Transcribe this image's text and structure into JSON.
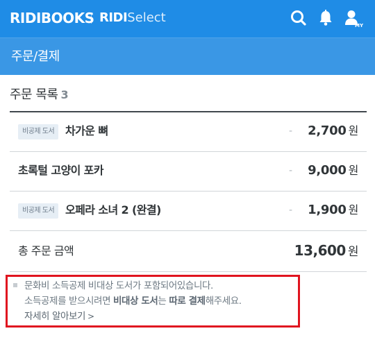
{
  "header": {
    "logo": "RIDIBOOKS",
    "select_logo_bold": "RIDI",
    "select_logo_light": "Select",
    "icons": [
      "search-icon",
      "bell-icon",
      "my-icon"
    ],
    "my_label": "MY",
    "colors": {
      "topbar": "#1f8ce6",
      "subbar": "#3a97e5"
    }
  },
  "page": {
    "title": "주문/결제"
  },
  "order": {
    "section_title": "주문 목록",
    "count": "3",
    "items": [
      {
        "badge": "비공제 도서",
        "title": "차가운 뼈",
        "dash": "-",
        "price": "2,700",
        "currency": "원"
      },
      {
        "badge": "",
        "title": "초록털 고양이 포카",
        "dash": "-",
        "price": "9,000",
        "currency": "원"
      },
      {
        "badge": "비공제 도서",
        "title": "오페라 소녀 2 (완결)",
        "dash": "-",
        "price": "1,900",
        "currency": "원"
      }
    ],
    "total_label": "총 주문 금액",
    "total_price": "13,600",
    "total_currency": "원"
  },
  "notice": {
    "line1": "문화비 소득공제 비대상 도서가 포함되어있습니다.",
    "line2_a": "소득공제를 받으시려면 ",
    "line2_b": "비대상 도서",
    "line2_c": "는 ",
    "line2_d": "따로 결제",
    "line2_e": "해주세요.",
    "link": "자세히 알아보기",
    "link_chevron": ">",
    "highlight_color": "#e0141f"
  }
}
